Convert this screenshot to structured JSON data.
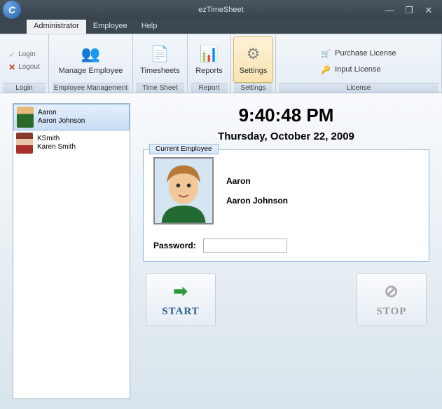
{
  "window": {
    "title": "ezTimeSheet"
  },
  "menu": {
    "admin": "Administrator",
    "employee": "Employee",
    "help": "Help"
  },
  "ribbon": {
    "login": "Login",
    "logout": "Logout",
    "login_group": "Login",
    "manage": "Manage Employee",
    "manage_group": "Employee Management",
    "timesheets": "Timesheets",
    "timesheets_group": "Time Sheet",
    "reports": "Reports",
    "reports_group": "Report",
    "settings": "Settings",
    "settings_group": "Settings",
    "purchase": "Purchase License",
    "input": "Input License",
    "license_group": "License"
  },
  "employees": [
    {
      "short": "Aaron",
      "full": "Aaron Johnson"
    },
    {
      "short": "KSmith",
      "full": "Karen Smith"
    }
  ],
  "clock": {
    "time": "9:40:48 PM",
    "date": "Thursday, October 22, 2009"
  },
  "panel": {
    "legend": "Current Employee",
    "first": "Aaron",
    "full": "Aaron Johnson",
    "password_label": "Password:"
  },
  "actions": {
    "start": "START",
    "stop": "STOP"
  }
}
